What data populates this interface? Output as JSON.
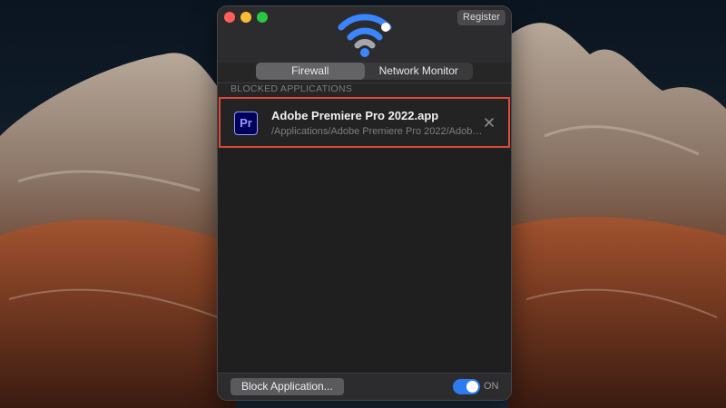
{
  "window": {
    "register_label": "Register",
    "tabs": [
      {
        "label": "Firewall",
        "active": true
      },
      {
        "label": "Network Monitor",
        "active": false
      }
    ],
    "section_title": "BLOCKED APPLICATIONS",
    "blocked_apps": [
      {
        "icon_text": "Pr",
        "name": "Adobe Premiere Pro 2022.app",
        "path": "/Applications/Adobe Premiere Pro 2022/Adobe..."
      }
    ],
    "block_button_label": "Block Application...",
    "toggle": {
      "state": "ON",
      "on": true
    }
  },
  "colors": {
    "accent": "#2d7bf0",
    "highlight_border": "#e0483c",
    "window_bg": "#262627",
    "premiere_icon_bg": "#00005b",
    "premiere_icon_fg": "#9999ff"
  },
  "icons": [
    "wifi-logo-icon",
    "close-x-icon",
    "premiere-app-icon"
  ]
}
